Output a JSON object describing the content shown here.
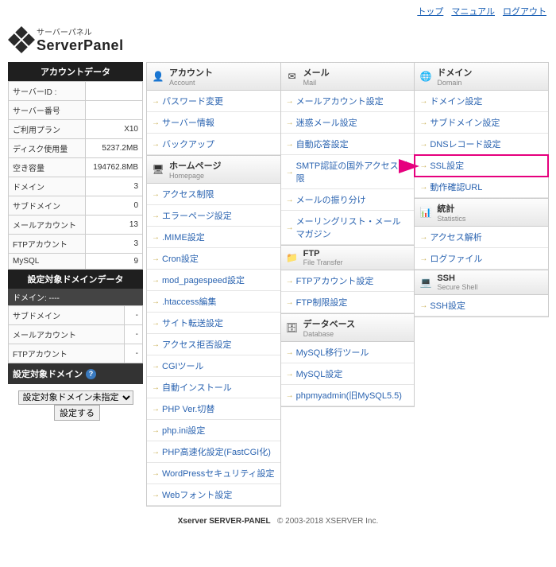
{
  "top_links": [
    "トップ",
    "マニュアル",
    "ログアウト"
  ],
  "logo": {
    "jp": "サーバーパネル",
    "en": "ServerPanel"
  },
  "acct_hdr": "アカウントデータ",
  "acct": [
    {
      "k": "サーバーID :",
      "v": ""
    },
    {
      "k": "サーバー番号",
      "v": ""
    },
    {
      "k": "ご利用プラン",
      "v": "X10"
    },
    {
      "k": "ディスク使用量",
      "v": "5237.2MB"
    },
    {
      "k": "空き容量",
      "v": "194762.8MB"
    },
    {
      "k": "ドメイン",
      "v": "3"
    },
    {
      "k": "サブドメイン",
      "v": "0"
    },
    {
      "k": "メールアカウント",
      "v": "13"
    },
    {
      "k": "FTPアカウント",
      "v": "3"
    },
    {
      "k": "MySQL",
      "v": "9"
    }
  ],
  "dom_hdr": "設定対象ドメインデータ",
  "dom_cur": "ドメイン:  ----",
  "dom_rows": [
    {
      "k": "サブドメイン",
      "v": "-"
    },
    {
      "k": "メールアカウント",
      "v": "-"
    },
    {
      "k": "FTPアカウント",
      "v": "-"
    }
  ],
  "dom_btn": "設定対象ドメイン",
  "sel_placeholder": "設定対象ドメイン未指定",
  "sel_btn": "設定する",
  "sections": [
    {
      "title": "アカウント",
      "sub": "Account",
      "ico": "👤",
      "col": 1,
      "items": [
        "パスワード変更",
        "サーバー情報",
        "バックアップ"
      ]
    },
    {
      "title": "メール",
      "sub": "Mail",
      "ico": "✉",
      "col": 2,
      "items": [
        "メールアカウント設定",
        "迷惑メール設定",
        "自動応答設定",
        "SMTP認証の国外アクセス制限",
        "メールの振り分け",
        "メーリングリスト・メールマガジン"
      ]
    },
    {
      "title": "ドメイン",
      "sub": "Domain",
      "ico": "🌐",
      "col": 3,
      "items": [
        "ドメイン設定",
        "サブドメイン設定",
        "DNSレコード設定",
        "SSL設定",
        "動作確認URL"
      ],
      "hl": 3
    },
    {
      "title": "ホームページ",
      "sub": "Homepage",
      "ico": "🖥",
      "col": 1,
      "items": [
        "アクセス制限",
        "エラーページ設定",
        ".MIME設定",
        "Cron設定",
        "mod_pagespeed設定",
        ".htaccess編集",
        "サイト転送設定",
        "アクセス拒否設定",
        "CGIツール",
        "自動インストール",
        "PHP Ver.切替",
        "php.ini設定",
        "PHP高速化設定(FastCGI化)",
        "WordPressセキュリティ設定",
        "Webフォント設定"
      ]
    },
    {
      "title": "FTP",
      "sub": "File Transfer",
      "ico": "📁",
      "col": 2,
      "items": [
        "FTPアカウント設定",
        "FTP制限設定"
      ]
    },
    {
      "title": "統計",
      "sub": "Statistics",
      "ico": "📊",
      "col": 3,
      "items": [
        "アクセス解析",
        "ログファイル"
      ]
    },
    {
      "title": "データベース",
      "sub": "Database",
      "ico": "🗄",
      "col": 2,
      "items": [
        "MySQL移行ツール",
        "MySQL設定",
        "phpmyadmin(旧MySQL5.5)"
      ]
    },
    {
      "title": "SSH",
      "sub": "Secure Shell",
      "ico": "💻",
      "col": 3,
      "items": [
        "SSH設定"
      ]
    }
  ],
  "ftr_l": "Xserver SERVER-PANEL",
  "ftr_r": "© 2003-2018 XSERVER Inc."
}
